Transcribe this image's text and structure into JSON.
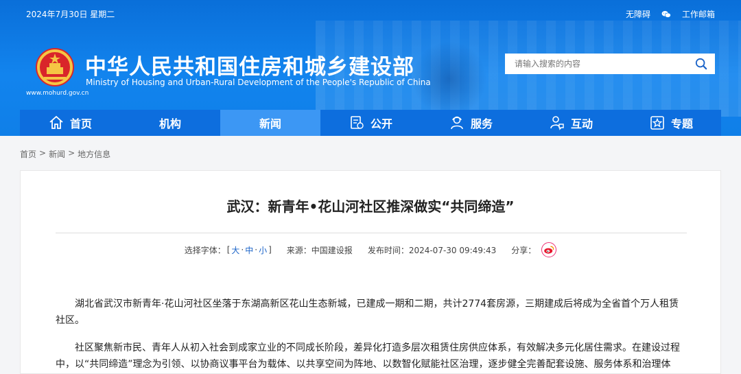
{
  "header": {
    "date": "2024年7月30日 星期二",
    "accessibility": "无障碍",
    "mailbox": "工作邮箱",
    "title": "中华人民共和国住房和城乡建设部",
    "subtitle": "Ministry of Housing and Urban-Rural Development of the People's Republic of China",
    "url": "www.mohurd.gov.cn",
    "search_placeholder": "请输入搜索的内容"
  },
  "nav": {
    "items": [
      {
        "label": "首页",
        "icon": "home-icon"
      },
      {
        "label": "机构",
        "icon": ""
      },
      {
        "label": "新闻",
        "icon": "",
        "active": true
      },
      {
        "label": "公开",
        "icon": "document-icon"
      },
      {
        "label": "服务",
        "icon": "user-service-icon"
      },
      {
        "label": "互动",
        "icon": "interaction-icon"
      },
      {
        "label": "专题",
        "icon": "star-icon"
      }
    ]
  },
  "breadcrumb": [
    "首页",
    "新闻",
    "地方信息"
  ],
  "article": {
    "title": "武汉：新青年•花山河社区推深做实“共同缔造”",
    "font_label": "选择字体：",
    "font_large": "大",
    "font_medium": "中",
    "font_small": "小",
    "source": "来源：中国建设报",
    "published": "发布时间：2024-07-30 09:49:43",
    "share": "分享：",
    "paragraphs": [
      "湖北省武汉市新青年·花山河社区坐落于东湖高新区花山生态新城，已建成一期和二期，共计2774套房源，三期建成后将成为全省首个万人租赁社区。",
      "社区聚焦新市民、青年人从初入社会到成家立业的不同成长阶段，差异化打造多层次租赁住房供应体系，有效解决多元化居住需求。在建设过程中，以“共同缔造”理念为引领、以协商议事平台为载体、以共享空间为阵地、以数智化赋能社区治理，逐步健全完善配套设施、服务体系和治理体系。"
    ]
  },
  "colors": {
    "header_blue": "#1284ee",
    "nav_blue": "#0d6ede",
    "nav_active": "#3c97f4",
    "link_blue": "#1a63c8"
  }
}
